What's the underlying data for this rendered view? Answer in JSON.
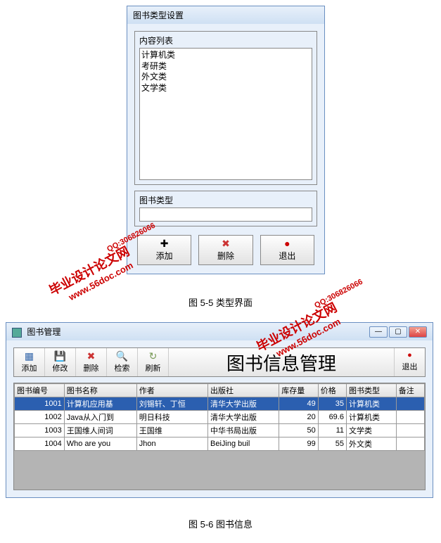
{
  "dialog1": {
    "title": "图书类型设置",
    "list_label": "内容列表",
    "items": [
      "计算机类",
      "考研类",
      "外文类",
      "文学类"
    ],
    "type_label": "图书类型",
    "type_value": "",
    "buttons": {
      "add": "添加",
      "delete": "删除",
      "exit": "退出"
    }
  },
  "caption1": "图 5-5 类型界面",
  "dialog2": {
    "title": "图书管理",
    "big_title": "图书信息管理",
    "toolbar": {
      "add": "添加",
      "edit": "修改",
      "delete": "删除",
      "search": "检索",
      "refresh": "刷新",
      "exit": "退出"
    },
    "columns": [
      "图书编号",
      "图书名称",
      "作者",
      "出版社",
      "库存量",
      "价格",
      "图书类型",
      "备注"
    ],
    "rows": [
      {
        "id": "1001",
        "name": "计算机应用基",
        "author": "刘锡轩、丁恒",
        "pub": "清华大学出版",
        "stock": "49",
        "price": "35",
        "type": "计算机类",
        "note": "",
        "selected": true
      },
      {
        "id": "1002",
        "name": "Java从入门到",
        "author": "明日科技",
        "pub": "清华大学出版",
        "stock": "20",
        "price": "69.6",
        "type": "计算机类",
        "note": ""
      },
      {
        "id": "1003",
        "name": "王国维人间词",
        "author": "王国维",
        "pub": "中华书局出版",
        "stock": "50",
        "price": "11",
        "type": "文学类",
        "note": ""
      },
      {
        "id": "1004",
        "name": "Who are you",
        "author": "Jhon",
        "pub": "BeiJing buil",
        "stock": "99",
        "price": "55",
        "type": "外文类",
        "note": ""
      }
    ]
  },
  "caption2": "图 5-6 图书信息",
  "watermark": {
    "line1": "毕业设计论文网",
    "line2": "www.56doc.com",
    "line3": "QQ:306826066"
  }
}
